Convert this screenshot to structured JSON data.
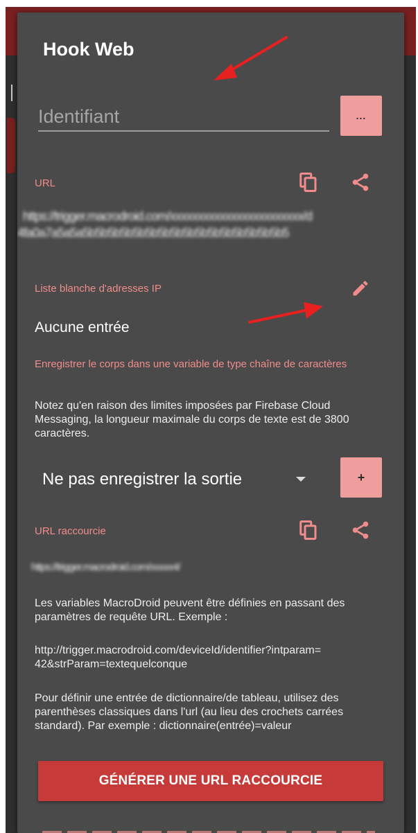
{
  "dialog": {
    "title": "Hook Web",
    "identifier": {
      "placeholder": "Identifiant",
      "more_button_label": "..."
    },
    "url": {
      "label": "URL",
      "value_line1": "https://trigger.macrodroid.com/xxxxxxxxxxxxxxxxxxxxxxxx/d",
      "value_line2": "4fa0a7a5a5a5b5b5b5b5b5b5b5b5b5b5b5b5b5b5b5b5"
    },
    "ip_whitelist": {
      "label": "Liste blanche d'adresses IP",
      "value": "Aucune entrée"
    },
    "save_body": {
      "label": "Enregistrer le corps dans une variable de type chaîne de caractères",
      "note": "Notez qu'en raison des limites imposées par Firebase Cloud Messaging, la longueur maximale du corps de texte est de 3800 caractères."
    },
    "output": {
      "selected": "Ne pas enregistrer la sortie",
      "add_button_label": "+"
    },
    "short_url": {
      "label": "URL raccourcie",
      "value": "https://trigger.macrodroid.com/xxxxx4/"
    },
    "info": {
      "variables": "Les variables MacroDroid peuvent être définies en passant des paramètres de requête URL. Exemple :",
      "example_line1": "http://trigger.macrodroid.com/deviceId/identifier?intparam=",
      "example_line2": "42&strParam=textequelconque",
      "dictionary": "Pour définir une entrée de dictionnaire/de tableau, utilisez des parenthèses classiques dans l'url (au lieu des crochets carrées standard). Par exemple : dictionnaire(entrée)=valeur"
    },
    "generate_button": "GÉNÉRER UNE URL RACCOURCIE"
  },
  "colors": {
    "dialog_bg": "#4a4a4a",
    "accent_red": "#c63a3a",
    "label_pink": "#f08c8c",
    "button_pink": "#f09d9d",
    "annotation_arrow": "#e82020"
  },
  "icons": [
    "copy-icon",
    "share-icon",
    "edit-pencil-icon",
    "dropdown-caret-icon"
  ]
}
